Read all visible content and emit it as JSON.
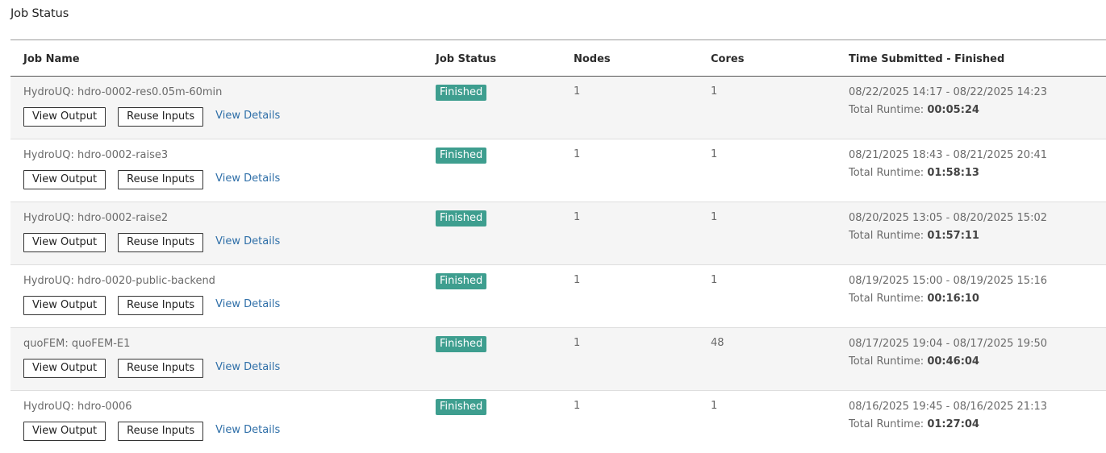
{
  "page": {
    "title": "Job Status"
  },
  "table": {
    "headers": [
      "Job Name",
      "Job Status",
      "Nodes",
      "Cores",
      "Time Submitted - Finished"
    ],
    "labels": {
      "view_output": "View Output",
      "reuse_inputs": "Reuse Inputs",
      "view_details": "View Details",
      "runtime_prefix": "Total Runtime:"
    },
    "status_color": "#3e9e8f",
    "rows": [
      {
        "name": "HydroUQ: hdro-0002-res0.05m-60min",
        "status": "Finished",
        "nodes": "1",
        "cores": "1",
        "time": "08/22/2025 14:17 - 08/22/2025 14:23",
        "runtime": "00:05:24"
      },
      {
        "name": "HydroUQ: hdro-0002-raise3",
        "status": "Finished",
        "nodes": "1",
        "cores": "1",
        "time": "08/21/2025 18:43 - 08/21/2025 20:41",
        "runtime": "01:58:13"
      },
      {
        "name": "HydroUQ: hdro-0002-raise2",
        "status": "Finished",
        "nodes": "1",
        "cores": "1",
        "time": "08/20/2025 13:05 - 08/20/2025 15:02",
        "runtime": "01:57:11"
      },
      {
        "name": "HydroUQ: hdro-0020-public-backend",
        "status": "Finished",
        "nodes": "1",
        "cores": "1",
        "time": "08/19/2025 15:00 - 08/19/2025 15:16",
        "runtime": "00:16:10"
      },
      {
        "name": "quoFEM: quoFEM-E1",
        "status": "Finished",
        "nodes": "1",
        "cores": "48",
        "time": "08/17/2025 19:04 - 08/17/2025 19:50",
        "runtime": "00:46:04"
      },
      {
        "name": "HydroUQ: hdro-0006",
        "status": "Finished",
        "nodes": "1",
        "cores": "1",
        "time": "08/16/2025 19:45 - 08/16/2025 21:13",
        "runtime": "01:27:04"
      }
    ]
  }
}
